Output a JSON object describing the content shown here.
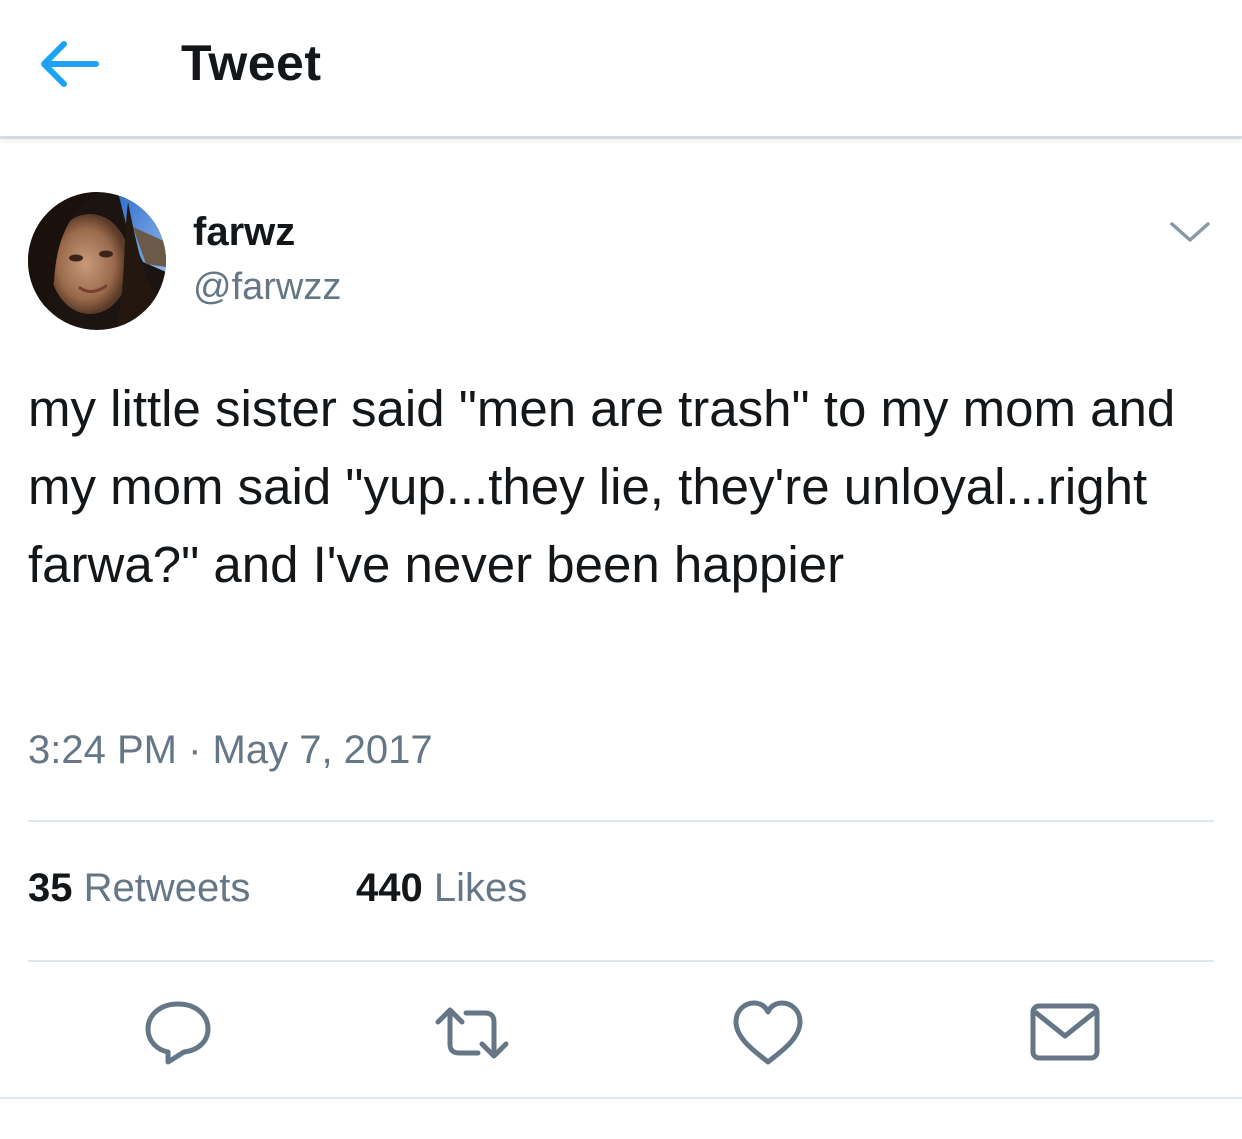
{
  "header": {
    "title": "Tweet",
    "back_icon": "arrow-left-icon",
    "accent_color": "#1da1f2"
  },
  "tweet": {
    "author": {
      "display_name": "farwz",
      "handle": "@farwzz",
      "avatar": "profile-photo"
    },
    "caret_icon": "chevron-down-icon",
    "text": "my little sister said \"men are trash\" to my mom and my mom said \"yup...they lie, they're unloyal...right farwa?\" and I've never been happier",
    "timestamp": "3:24 PM · May 7, 2017"
  },
  "stats": {
    "retweets_count": "35",
    "retweets_label": "Retweets",
    "likes_count": "440",
    "likes_label": "Likes"
  },
  "actions": [
    {
      "name": "reply",
      "icon": "reply-icon"
    },
    {
      "name": "retweet",
      "icon": "retweet-icon"
    },
    {
      "name": "like",
      "icon": "heart-icon"
    },
    {
      "name": "direct-message",
      "icon": "envelope-icon"
    }
  ],
  "colors": {
    "text_primary": "#14171a",
    "text_secondary": "#657786",
    "divider": "#e1e8ed",
    "icon": "#657786"
  }
}
